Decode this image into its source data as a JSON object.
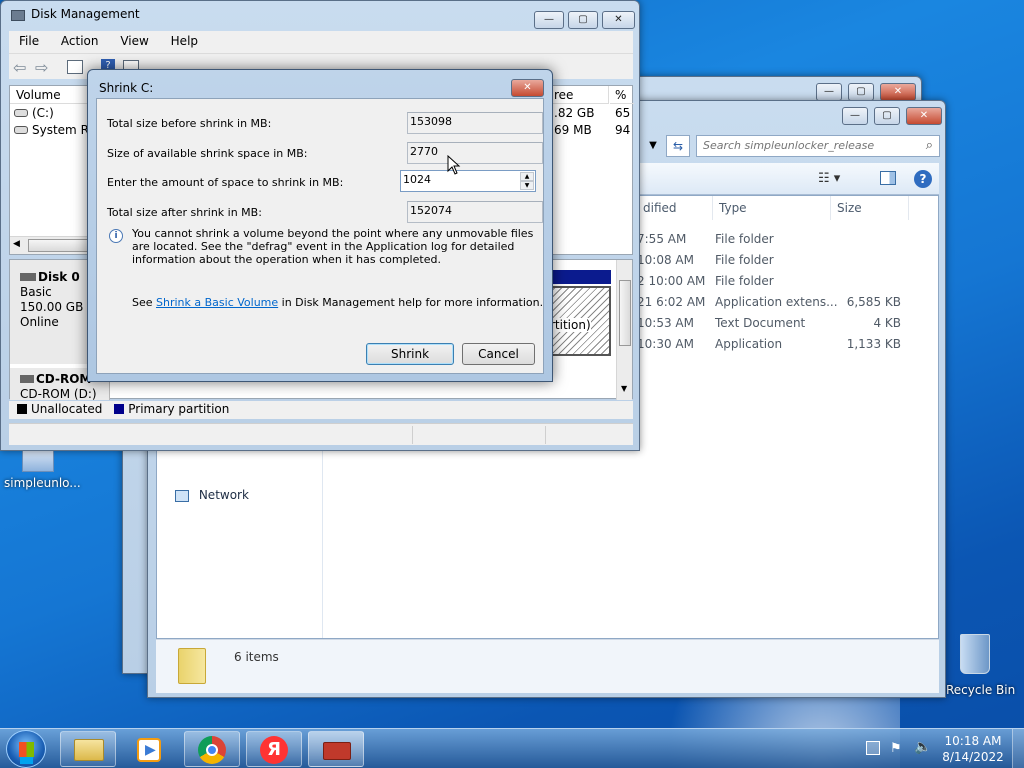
{
  "desktop": {
    "icons": [
      {
        "label": "simpleunlo..."
      },
      {
        "label": "Recycle Bin"
      }
    ]
  },
  "explorer_back": {
    "controls": [
      "min",
      "max",
      "close"
    ]
  },
  "explorer": {
    "search_placeholder": "Search simpleunlocker_release",
    "columns": {
      "modified": "dified",
      "type": "Type",
      "size": "Size"
    },
    "rows": [
      {
        "modified": "7:55 AM",
        "type": "File folder",
        "size": ""
      },
      {
        "modified": "10:08 AM",
        "type": "File folder",
        "size": ""
      },
      {
        "modified": "2 10:00 AM",
        "type": "File folder",
        "size": ""
      },
      {
        "modified": "21 6:02 AM",
        "type": "Application extens...",
        "size": "6,585 KB"
      },
      {
        "modified": "10:53 AM",
        "type": "Text Document",
        "size": "4 KB"
      },
      {
        "modified": "10:30 AM",
        "type": "Application",
        "size": "1,133 KB"
      }
    ],
    "nav_network": "Network",
    "status_items": "6 items"
  },
  "disk_mgmt": {
    "title": "Disk Management",
    "menu": [
      "File",
      "Action",
      "View",
      "Help"
    ],
    "volume_header": "Volume",
    "free_header": "ree Spa...",
    "pct_header": "% F",
    "volumes": [
      {
        "name": "(C:)",
        "free": ".82 GB",
        "pct": "65"
      },
      {
        "name": "System Res",
        "free": "69 MB",
        "pct": "94"
      }
    ],
    "disk0": {
      "name": "Disk 0",
      "type": "Basic",
      "size": "150.00 GB",
      "status": "Online"
    },
    "partition_label": "rtition)",
    "cdrom": {
      "name": "CD-ROM",
      "sub": "CD-ROM (D:)"
    },
    "legend": {
      "unallocated": "Unallocated",
      "primary": "Primary partition"
    },
    "colors": {
      "unallocated": "#000000",
      "primary": "#00008b"
    }
  },
  "shrink": {
    "title": "Shrink C:",
    "total_before_label": "Total size before shrink in MB:",
    "total_before_value": "153098",
    "available_label": "Size of available shrink space in MB:",
    "available_value": "2770",
    "amount_label": "Enter the amount of space to shrink in MB:",
    "amount_value": "1024",
    "total_after_label": "Total size after shrink in MB:",
    "total_after_value": "152074",
    "info_text": "You cannot shrink a volume beyond the point where any unmovable files are located. See the \"defrag\" event in the Application log for detailed information about the operation when it has completed.",
    "see_prefix": "See ",
    "see_link": "Shrink a Basic Volume",
    "see_suffix": " in Disk Management help for more information.",
    "shrink_button": "Shrink",
    "cancel_button": "Cancel",
    "link_color": "#0066cc"
  },
  "taskbar": {
    "time": "10:18 AM",
    "date": "8/14/2022",
    "apps": [
      "windows-explorer",
      "media-player",
      "chrome",
      "yandex-browser",
      "disk-management"
    ],
    "yandex_letter": "Я"
  }
}
